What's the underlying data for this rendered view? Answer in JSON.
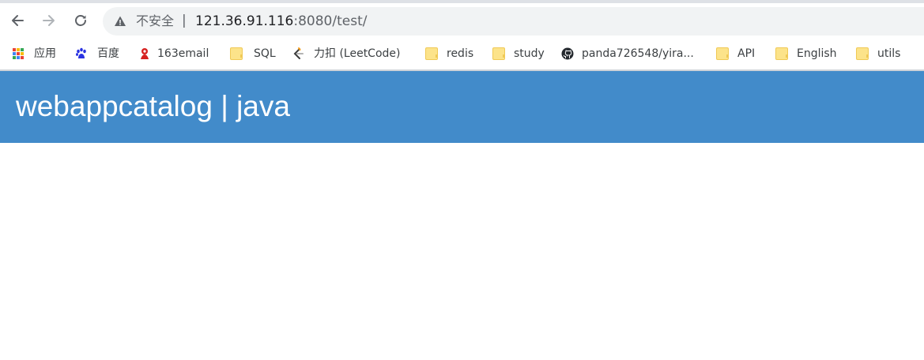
{
  "browser": {
    "security_label": "不安全",
    "url_separator": "|",
    "url_host": "121.36.91.116",
    "url_rest": ":8080/test/"
  },
  "bookmarks": [
    {
      "label": "应用",
      "icon": "apps-grid-icon"
    },
    {
      "label": "百度",
      "icon": "baidu-paw-icon"
    },
    {
      "label": "163email",
      "icon": "netease-163-icon"
    },
    {
      "label": "SQL",
      "icon": "folder-icon"
    },
    {
      "label": "力扣 (LeetCode)",
      "icon": "leetcode-icon"
    },
    {
      "label": "redis",
      "icon": "folder-icon"
    },
    {
      "label": "study",
      "icon": "folder-icon"
    },
    {
      "label": "panda726548/yira...",
      "icon": "github-icon"
    },
    {
      "label": "API",
      "icon": "folder-icon"
    },
    {
      "label": "English",
      "icon": "folder-icon"
    },
    {
      "label": "utils",
      "icon": "folder-icon"
    }
  ],
  "page": {
    "header_title": "webappcatalog | java",
    "header_color": "#428bca"
  }
}
